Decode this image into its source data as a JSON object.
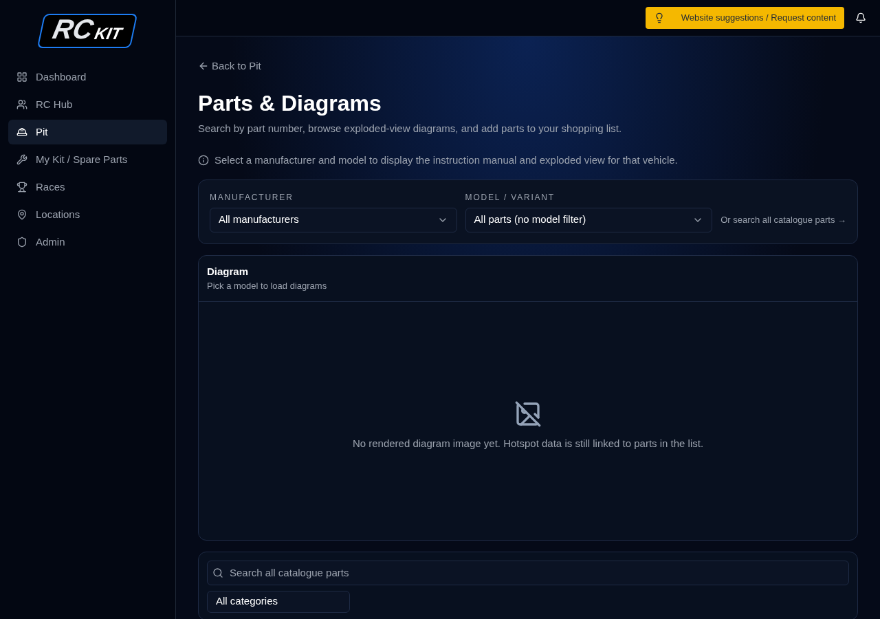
{
  "logo": {
    "part1": "RC",
    "part2": "KIT"
  },
  "sidebar": {
    "items": [
      {
        "label": "Dashboard",
        "selected": false
      },
      {
        "label": "RC Hub",
        "selected": false
      },
      {
        "label": "Pit",
        "selected": true
      },
      {
        "label": "My Kit / Spare Parts",
        "selected": false
      },
      {
        "label": "Races",
        "selected": false
      },
      {
        "label": "Locations",
        "selected": false
      },
      {
        "label": "Admin",
        "selected": false
      }
    ]
  },
  "topbar": {
    "suggest_button": "Website suggestions / Request content"
  },
  "back_link": "Back to Pit",
  "title": "Parts & Diagrams",
  "subtitle": "Search by part number, browse exploded-view diagrams, and add parts to your shopping list.",
  "info": "Select a manufacturer and model to display the instruction manual and exploded view for that vehicle.",
  "filters": {
    "manufacturer": {
      "label": "MANUFACTURER",
      "value": "All manufacturers"
    },
    "model": {
      "label": "MODEL / VARIANT",
      "value": "All parts (no model filter)"
    },
    "catalogue_link": "Or search all catalogue parts →"
  },
  "diagram": {
    "title": "Diagram",
    "subtitle": "Pick a model to load diagrams",
    "empty": "No rendered diagram image yet. Hotspot data is still linked to parts in the list."
  },
  "parts": {
    "search_placeholder": "Search all catalogue parts",
    "category": "All categories"
  }
}
